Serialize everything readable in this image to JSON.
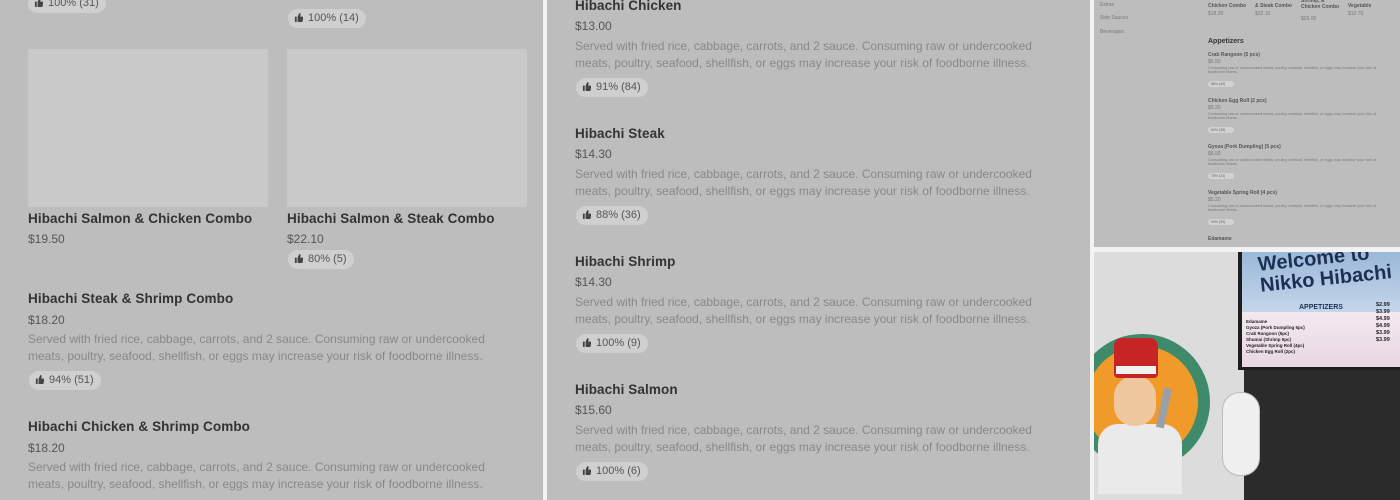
{
  "panel1": {
    "top_rating": "100% (31)",
    "top_rating_right": "100% (14)",
    "cards": [
      {
        "name": "Hibachi Salmon & Chicken Combo",
        "price": "$19.50"
      },
      {
        "name": "Hibachi Salmon & Steak Combo",
        "price": "$22.10",
        "rating": "80% (5)"
      }
    ],
    "items": [
      {
        "name": "Hibachi Steak & Shrimp Combo",
        "price": "$18.20",
        "desc": "Served with fried rice, cabbage, carrots, and 2 sauce. Consuming raw or undercooked meats, poultry, seafood, shellfish, or eggs may increase your risk of foodborne illness.",
        "rating": "94% (51)"
      },
      {
        "name": "Hibachi Chicken & Shrimp Combo",
        "price": "$18.20",
        "desc": "Served with fried rice, cabbage, carrots, and 2 sauce. Consuming raw or undercooked meats, poultry, seafood, shellfish, or eggs may increase your risk of foodborne illness."
      }
    ]
  },
  "panel2": {
    "items": [
      {
        "name": "Hibachi Chicken",
        "price": "$13.00",
        "desc": "Served with fried rice, cabbage, carrots, and 2 sauce. Consuming raw or undercooked meats, poultry, seafood, shellfish, or eggs may increase your risk of foodborne illness.",
        "rating": "91% (84)"
      },
      {
        "name": "Hibachi Steak",
        "price": "$14.30",
        "desc": "Served with fried rice, cabbage, carrots, and 2 sauce. Consuming raw or undercooked meats, poultry, seafood, shellfish, or eggs may increase your risk of foodborne illness.",
        "rating": "88% (36)"
      },
      {
        "name": "Hibachi Shrimp",
        "price": "$14.30",
        "desc": "Served with fried rice, cabbage, carrots, and 2 sauce. Consuming raw or undercooked meats, poultry, seafood, shellfish, or eggs may increase your risk of foodborne illness.",
        "rating": "100% (9)"
      },
      {
        "name": "Hibachi Salmon",
        "price": "$15.60",
        "desc": "Served with fried rice, cabbage, carrots, and 2 sauce. Consuming raw or undercooked meats, poultry, seafood, shellfish, or eggs may increase your risk of foodborne illness.",
        "rating": "100% (6)"
      }
    ]
  },
  "panel3": {
    "sidebar": [
      "Extras",
      "Side Sauces",
      "Beverages"
    ],
    "top_items": [
      {
        "name": "Chicken Combo",
        "price": "$18.20"
      },
      {
        "name": "& Steak Combo",
        "price": "$22.10"
      },
      {
        "name": "Shrimp, & Chicken Combo",
        "price": "$26.00"
      },
      {
        "name": "Vegetable",
        "price": "$12.70"
      }
    ],
    "section_title": "Appetizers",
    "appetizers": [
      {
        "name": "Crab Rangoon (5 pcs)",
        "price": "$6.50",
        "rating": "88% (40)"
      },
      {
        "name": "Chicken Egg Roll (2 pcs)",
        "price": "$5.20",
        "rating": "84% (38)"
      },
      {
        "name": "Gyoza (Pork Dumpling) (5 pcs)",
        "price": "$6.50",
        "rating": "78% (23)"
      },
      {
        "name": "Vegetable Spring Roll (4 pcs)",
        "price": "$5.20",
        "rating": "90% (30)"
      }
    ],
    "last_item": "Edamame",
    "desc_short": "Consuming raw or undercooked meats, poultry, seafood, shellfish, or eggs may increase your risk of foodborne illness."
  },
  "panel4": {
    "welcome": "Welcome to Nikko Hibachi",
    "appetizers_label": "APPETIZERS",
    "menu_lines": [
      "Edamame",
      "Gyoza (Pork Dumpling 5pc)",
      "Crab Rangoon (5pc)",
      "Shumai (Shrimp 5pc)",
      "Vegetable Spring Roll (4pc)",
      "Chicken Egg Roll (2pc)"
    ],
    "menu_prices": [
      "$2.99",
      "$3.99",
      "$4.99",
      "$4.99",
      "$3.99",
      "$3.99"
    ]
  }
}
